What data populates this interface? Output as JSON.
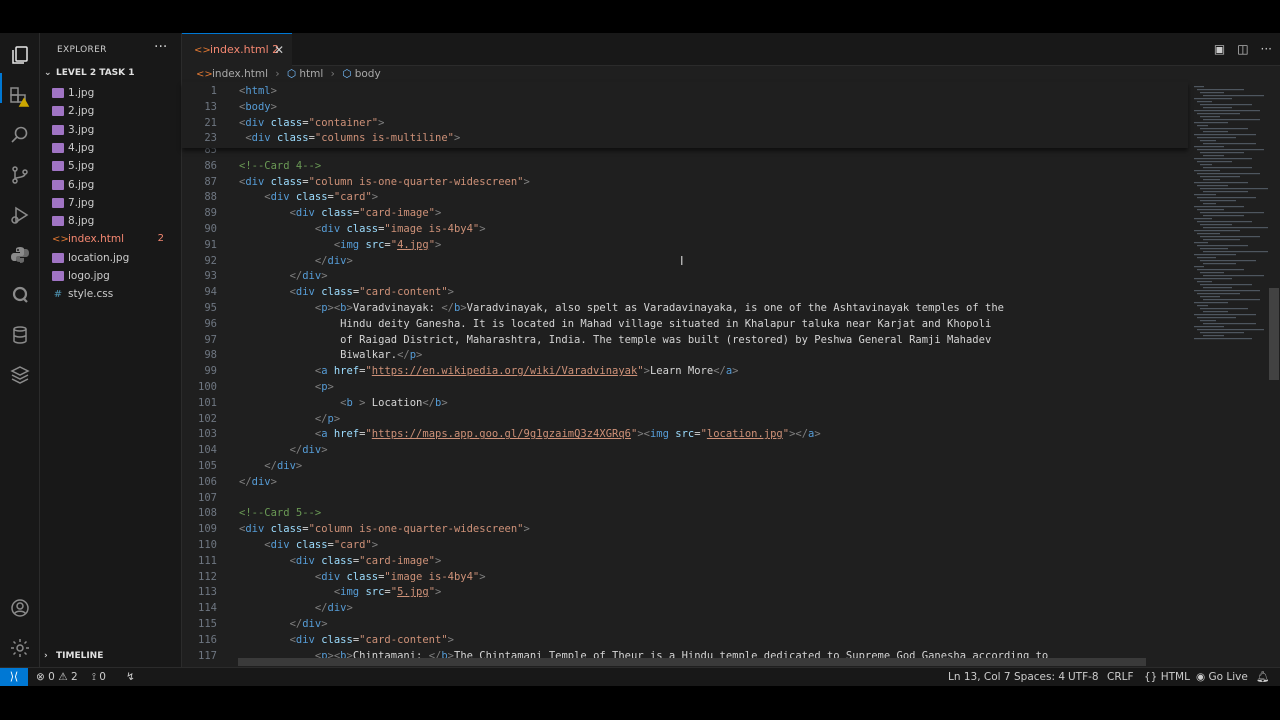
{
  "explorer": {
    "title": "EXPLORER",
    "more": "···",
    "folder": "LEVEL 2 TASK 1",
    "files": [
      {
        "name": "1.jpg",
        "type": "image"
      },
      {
        "name": "2.jpg",
        "type": "image"
      },
      {
        "name": "3.jpg",
        "type": "image"
      },
      {
        "name": "4.jpg",
        "type": "image"
      },
      {
        "name": "5.jpg",
        "type": "image"
      },
      {
        "name": "6.jpg",
        "type": "image"
      },
      {
        "name": "7.jpg",
        "type": "image"
      },
      {
        "name": "8.jpg",
        "type": "image"
      },
      {
        "name": "index.html",
        "type": "html",
        "badge": "2"
      },
      {
        "name": "location.jpg",
        "type": "image"
      },
      {
        "name": "logo.jpg",
        "type": "image"
      },
      {
        "name": "style.css",
        "type": "css"
      }
    ],
    "timeline": "TIMELINE"
  },
  "tab": {
    "label": "index.html 2",
    "close": "✕"
  },
  "breadcrumb": {
    "file": "index.html",
    "item1": "html",
    "item2": "body"
  },
  "sticky": [
    {
      "num": "1",
      "html": "<span class=\"tag\">&lt;</span><span class=\"tn\">html</span><span class=\"tag\">&gt;</span>"
    },
    {
      "num": "13",
      "html": "<span class=\"tag\">&lt;</span><span class=\"tn\">body</span><span class=\"tag\">&gt;</span>"
    },
    {
      "num": "21",
      "html": "<span class=\"tag\">&lt;</span><span class=\"tn\">div</span> <span class=\"an\">class</span><span class=\"tx\">=</span><span class=\"av\">\"container\"</span><span class=\"tag\">&gt;</span>"
    },
    {
      "num": "23",
      "html": " <span class=\"tag\">&lt;</span><span class=\"tn\">div</span> <span class=\"an\">class</span><span class=\"tx\">=</span><span class=\"av\">\"columns is-multiline\"</span><span class=\"tag\">&gt;</span>"
    }
  ],
  "lines": [
    {
      "num": "85",
      "html": ""
    },
    {
      "num": "86",
      "html": "<span class=\"cm\">&lt;!--Card 4--&gt;</span>"
    },
    {
      "num": "87",
      "html": "<span class=\"tag\">&lt;</span><span class=\"tn\">div</span> <span class=\"an\">class</span><span class=\"tx\">=</span><span class=\"av\">\"column is-one-quarter-widescreen\"</span><span class=\"tag\">&gt;</span>"
    },
    {
      "num": "88",
      "html": "    <span class=\"tag\">&lt;</span><span class=\"tn\">div</span> <span class=\"an\">class</span><span class=\"tx\">=</span><span class=\"av\">\"card\"</span><span class=\"tag\">&gt;</span>"
    },
    {
      "num": "89",
      "html": "        <span class=\"tag\">&lt;</span><span class=\"tn\">div</span> <span class=\"an\">class</span><span class=\"tx\">=</span><span class=\"av\">\"card-image\"</span><span class=\"tag\">&gt;</span>"
    },
    {
      "num": "90",
      "html": "            <span class=\"tag\">&lt;</span><span class=\"tn\">div</span> <span class=\"an\">class</span><span class=\"tx\">=</span><span class=\"av\">\"image is-4by4\"</span><span class=\"tag\">&gt;</span>"
    },
    {
      "num": "91",
      "html": "               <span class=\"tag\">&lt;</span><span class=\"tn\">img</span> <span class=\"an\">src</span><span class=\"tx\">=</span><span class=\"av\">\"<span class=\"ul\">4.jpg</span>\"</span><span class=\"tag\">&gt;</span>"
    },
    {
      "num": "92",
      "html": "            <span class=\"tag\">&lt;/</span><span class=\"tn\">div</span><span class=\"tag\">&gt;</span>"
    },
    {
      "num": "93",
      "html": "        <span class=\"tag\">&lt;/</span><span class=\"tn\">div</span><span class=\"tag\">&gt;</span>"
    },
    {
      "num": "94",
      "html": "        <span class=\"tag\">&lt;</span><span class=\"tn\">div</span> <span class=\"an\">class</span><span class=\"tx\">=</span><span class=\"av\">\"card-content\"</span><span class=\"tag\">&gt;</span>"
    },
    {
      "num": "95",
      "html": "            <span class=\"tag\">&lt;</span><span class=\"tn\">p</span><span class=\"tag\">&gt;&lt;</span><span class=\"tn\">b</span><span class=\"tag\">&gt;</span><span class=\"tx\">Varadvinayak: </span><span class=\"tag\">&lt;/</span><span class=\"tn\">b</span><span class=\"tag\">&gt;</span><span class=\"tx\">Varadvinayak, also spelt as Varadavinayaka, is one of the Ashtavinayak temples of the</span>"
    },
    {
      "num": "96",
      "html": "                <span class=\"tx\">Hindu deity Ganesha. It is located in Mahad village situated in Khalapur taluka near Karjat and Khopoli</span>"
    },
    {
      "num": "97",
      "html": "                <span class=\"tx\">of Raigad District, Maharashtra, India. The temple was built (restored) by Peshwa General Ramji Mahadev</span>"
    },
    {
      "num": "98",
      "html": "                <span class=\"tx\">Biwalkar.</span><span class=\"tag\">&lt;/</span><span class=\"tn\">p</span><span class=\"tag\">&gt;</span>"
    },
    {
      "num": "99",
      "html": "            <span class=\"tag\">&lt;</span><span class=\"tn\">a</span> <span class=\"an\">href</span><span class=\"tx\">=</span><span class=\"av\">\"<span class=\"ul\">https://en.wikipedia.org/wiki/Varadvinayak</span>\"</span><span class=\"tag\">&gt;</span><span class=\"tx\">Learn More</span><span class=\"tag\">&lt;/</span><span class=\"tn\">a</span><span class=\"tag\">&gt;</span>"
    },
    {
      "num": "100",
      "html": "            <span class=\"tag\">&lt;</span><span class=\"tn\">p</span><span class=\"tag\">&gt;</span>"
    },
    {
      "num": "101",
      "html": "                <span class=\"tag\">&lt;</span><span class=\"tn\">b</span> <span class=\"tag\">&gt;</span> <span class=\"tx\">Location</span><span class=\"tag\">&lt;/</span><span class=\"tn\">b</span><span class=\"tag\">&gt;</span>"
    },
    {
      "num": "102",
      "html": "            <span class=\"tag\">&lt;/</span><span class=\"tn\">p</span><span class=\"tag\">&gt;</span>"
    },
    {
      "num": "103",
      "html": "            <span class=\"tag\">&lt;</span><span class=\"tn\">a</span> <span class=\"an\">href</span><span class=\"tx\">=</span><span class=\"av\">\"<span class=\"ul\">https://maps.app.goo.gl/9g1gzaimQ3z4XGRq6</span>\"</span><span class=\"tag\">&gt;&lt;</span><span class=\"tn\">img</span> <span class=\"an\">src</span><span class=\"tx\">=</span><span class=\"av\">\"<span class=\"ul\">location.jpg</span>\"</span><span class=\"tag\">&gt;&lt;/</span><span class=\"tn\">a</span><span class=\"tag\">&gt;</span>"
    },
    {
      "num": "104",
      "html": "        <span class=\"tag\">&lt;/</span><span class=\"tn\">div</span><span class=\"tag\">&gt;</span>"
    },
    {
      "num": "105",
      "html": "    <span class=\"tag\">&lt;/</span><span class=\"tn\">div</span><span class=\"tag\">&gt;</span>"
    },
    {
      "num": "106",
      "html": "<span class=\"tag\">&lt;/</span><span class=\"tn\">div</span><span class=\"tag\">&gt;</span>"
    },
    {
      "num": "107",
      "html": ""
    },
    {
      "num": "108",
      "html": "<span class=\"cm\">&lt;!--Card 5--&gt;</span>"
    },
    {
      "num": "109",
      "html": "<span class=\"tag\">&lt;</span><span class=\"tn\">div</span> <span class=\"an\">class</span><span class=\"tx\">=</span><span class=\"av\">\"column is-one-quarter-widescreen\"</span><span class=\"tag\">&gt;</span>"
    },
    {
      "num": "110",
      "html": "    <span class=\"tag\">&lt;</span><span class=\"tn\">div</span> <span class=\"an\">class</span><span class=\"tx\">=</span><span class=\"av\">\"card\"</span><span class=\"tag\">&gt;</span>"
    },
    {
      "num": "111",
      "html": "        <span class=\"tag\">&lt;</span><span class=\"tn\">div</span> <span class=\"an\">class</span><span class=\"tx\">=</span><span class=\"av\">\"card-image\"</span><span class=\"tag\">&gt;</span>"
    },
    {
      "num": "112",
      "html": "            <span class=\"tag\">&lt;</span><span class=\"tn\">div</span> <span class=\"an\">class</span><span class=\"tx\">=</span><span class=\"av\">\"image is-4by4\"</span><span class=\"tag\">&gt;</span>"
    },
    {
      "num": "113",
      "html": "               <span class=\"tag\">&lt;</span><span class=\"tn\">img</span> <span class=\"an\">src</span><span class=\"tx\">=</span><span class=\"av\">\"<span class=\"ul\">5.jpg</span>\"</span><span class=\"tag\">&gt;</span>"
    },
    {
      "num": "114",
      "html": "            <span class=\"tag\">&lt;/</span><span class=\"tn\">div</span><span class=\"tag\">&gt;</span>"
    },
    {
      "num": "115",
      "html": "        <span class=\"tag\">&lt;/</span><span class=\"tn\">div</span><span class=\"tag\">&gt;</span>"
    },
    {
      "num": "116",
      "html": "        <span class=\"tag\">&lt;</span><span class=\"tn\">div</span> <span class=\"an\">class</span><span class=\"tx\">=</span><span class=\"av\">\"card-content\"</span><span class=\"tag\">&gt;</span>"
    },
    {
      "num": "117",
      "html": "            <span class=\"tag\">&lt;</span><span class=\"tn\">p</span><span class=\"tag\">&gt;&lt;</span><span class=\"tn\">b</span><span class=\"tag\">&gt;</span><span class=\"tx\">Chintamani: </span><span class=\"tag\">&lt;/</span><span class=\"tn\">b</span><span class=\"tag\">&gt;</span><span class=\"tx\">The Chintamani Temple of Theur is a Hindu temple dedicated to Supreme God Ganesha according to</span>"
    }
  ],
  "status": {
    "remote": "⟩⟨",
    "errors": "0",
    "warnings": "2",
    "ports": "0",
    "position": "Ln 13, Col 7",
    "spaces": "Spaces: 4",
    "encoding": "UTF-8",
    "eol": "CRLF",
    "language": "HTML",
    "golive": "Go Live"
  },
  "colors": {
    "accent": "#0078d4",
    "error": "#f48771"
  }
}
